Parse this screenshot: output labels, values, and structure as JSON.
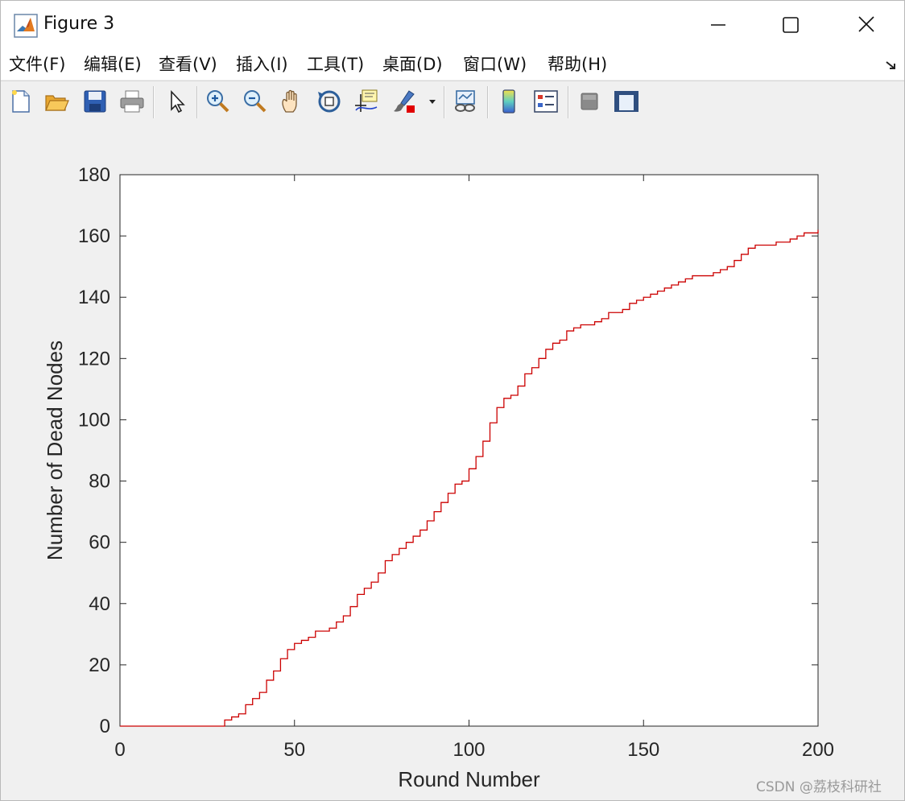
{
  "window": {
    "title": "Figure 3",
    "icon": "matlab-logo-icon"
  },
  "menu": [
    {
      "label": "文件(F)",
      "key": "F"
    },
    {
      "label": "编辑(E)",
      "key": "E"
    },
    {
      "label": "查看(V)",
      "key": "V"
    },
    {
      "label": "插入(I)",
      "key": "I"
    },
    {
      "label": "工具(T)",
      "key": "T"
    },
    {
      "label": "桌面(D)",
      "key": "D"
    },
    {
      "label": "窗口(W)",
      "key": "W"
    },
    {
      "label": "帮助(H)",
      "key": "H"
    }
  ],
  "toolbar": {
    "icons": [
      "new-figure-icon",
      "open-file-icon",
      "save-icon",
      "print-icon",
      "edit-plot-arrow-icon",
      "zoom-in-icon",
      "zoom-out-icon",
      "pan-hand-icon",
      "rotate-3d-icon",
      "data-cursor-icon",
      "brush-icon",
      "link-plot-icon",
      "insert-colorbar-icon",
      "insert-legend-icon",
      "hide-plot-tools-icon",
      "show-plot-tools-icon"
    ]
  },
  "colors": {
    "line": "#cc0000",
    "axes_text": "#262626",
    "figure_bg": "#f0f0f0"
  },
  "chart_data": {
    "type": "line",
    "title": "",
    "xlabel": "Round Number",
    "ylabel": "Number of Dead Nodes",
    "xlim": [
      0,
      200
    ],
    "ylim": [
      0,
      180
    ],
    "xticks": [
      0,
      50,
      100,
      150,
      200
    ],
    "yticks": [
      0,
      20,
      40,
      60,
      80,
      100,
      120,
      140,
      160,
      180
    ],
    "grid": false,
    "legend": "none",
    "series": [
      {
        "x": [
          0,
          28,
          30,
          32,
          34,
          36,
          38,
          40,
          42,
          44,
          46,
          48,
          50,
          52,
          54,
          56,
          58,
          60,
          62,
          64,
          66,
          68,
          70,
          72,
          74,
          76,
          78,
          80,
          82,
          84,
          86,
          88,
          90,
          92,
          94,
          96,
          98,
          100,
          102,
          104,
          106,
          108,
          110,
          112,
          114,
          116,
          118,
          120,
          122,
          124,
          126,
          128,
          130,
          132,
          134,
          136,
          138,
          140,
          142,
          144,
          146,
          148,
          150,
          152,
          154,
          156,
          158,
          160,
          162,
          164,
          166,
          168,
          170,
          172,
          174,
          176,
          178,
          180,
          182,
          184,
          186,
          188,
          190,
          192,
          194,
          196,
          198,
          200
        ],
        "y": [
          0,
          0,
          2,
          3,
          4,
          7,
          9,
          11,
          15,
          18,
          22,
          25,
          27,
          28,
          29,
          31,
          31,
          32,
          34,
          36,
          39,
          43,
          45,
          47,
          50,
          54,
          56,
          58,
          60,
          62,
          64,
          67,
          70,
          73,
          76,
          79,
          80,
          84,
          88,
          93,
          99,
          104,
          107,
          108,
          111,
          115,
          117,
          120,
          123,
          125,
          126,
          129,
          130,
          131,
          131,
          132,
          133,
          135,
          135,
          136,
          138,
          139,
          140,
          141,
          142,
          143,
          144,
          145,
          146,
          147,
          147,
          147,
          148,
          149,
          150,
          152,
          154,
          156,
          157,
          157,
          157,
          158,
          158,
          159,
          160,
          161,
          161,
          162
        ]
      }
    ]
  },
  "watermark": "CSDN @荔枝科研社"
}
